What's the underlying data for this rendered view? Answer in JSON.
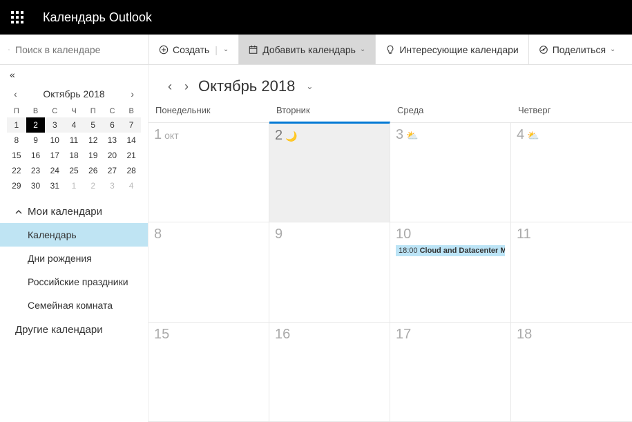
{
  "header": {
    "title": "Календарь Outlook"
  },
  "search": {
    "placeholder": "Поиск в календаре"
  },
  "toolbar": {
    "create": "Создать",
    "add_calendar": "Добавить календарь",
    "interesting": "Интересующие календари",
    "share": "Поделиться"
  },
  "mini": {
    "title": "Октябрь 2018",
    "dow": [
      "П",
      "В",
      "С",
      "Ч",
      "П",
      "С",
      "В"
    ],
    "weeks": [
      [
        {
          "n": 1,
          "shade": true
        },
        {
          "n": 2,
          "today": true
        },
        {
          "n": 3,
          "shade": true
        },
        {
          "n": 4,
          "shade": true
        },
        {
          "n": 5,
          "shade": true
        },
        {
          "n": 6,
          "shade": true
        },
        {
          "n": 7,
          "shade": true
        }
      ],
      [
        {
          "n": 8
        },
        {
          "n": 9
        },
        {
          "n": 10
        },
        {
          "n": 11
        },
        {
          "n": 12
        },
        {
          "n": 13
        },
        {
          "n": 14
        }
      ],
      [
        {
          "n": 15
        },
        {
          "n": 16
        },
        {
          "n": 17
        },
        {
          "n": 18
        },
        {
          "n": 19
        },
        {
          "n": 20
        },
        {
          "n": 21
        }
      ],
      [
        {
          "n": 22
        },
        {
          "n": 23
        },
        {
          "n": 24
        },
        {
          "n": 25
        },
        {
          "n": 26
        },
        {
          "n": 27
        },
        {
          "n": 28
        }
      ],
      [
        {
          "n": 29
        },
        {
          "n": 30
        },
        {
          "n": 31
        },
        {
          "n": 1,
          "other": true
        },
        {
          "n": 2,
          "other": true
        },
        {
          "n": 3,
          "other": true
        },
        {
          "n": 4,
          "other": true
        }
      ]
    ]
  },
  "sidebar": {
    "my_calendars": "Мои календари",
    "items": [
      {
        "label": "Календарь",
        "selected": true
      },
      {
        "label": "Дни рождения"
      },
      {
        "label": "Российские праздники"
      },
      {
        "label": "Семейная комната"
      }
    ],
    "other_calendars": "Другие календари"
  },
  "calendar": {
    "title": "Октябрь 2018",
    "dow": [
      "Понедельник",
      "Вторник",
      "Среда",
      "Четверг"
    ],
    "cells": [
      {
        "n": "1",
        "suffix": "окт"
      },
      {
        "n": "2",
        "today": true,
        "wx": "🌙"
      },
      {
        "n": "3",
        "wx": "⛅"
      },
      {
        "n": "4",
        "wx": "⛅"
      },
      {
        "n": "8"
      },
      {
        "n": "9"
      },
      {
        "n": "10",
        "event": {
          "time": "18:00",
          "title": "Cloud and Datacenter Ma"
        }
      },
      {
        "n": "11"
      },
      {
        "n": "15"
      },
      {
        "n": "16"
      },
      {
        "n": "17"
      },
      {
        "n": "18"
      }
    ]
  }
}
